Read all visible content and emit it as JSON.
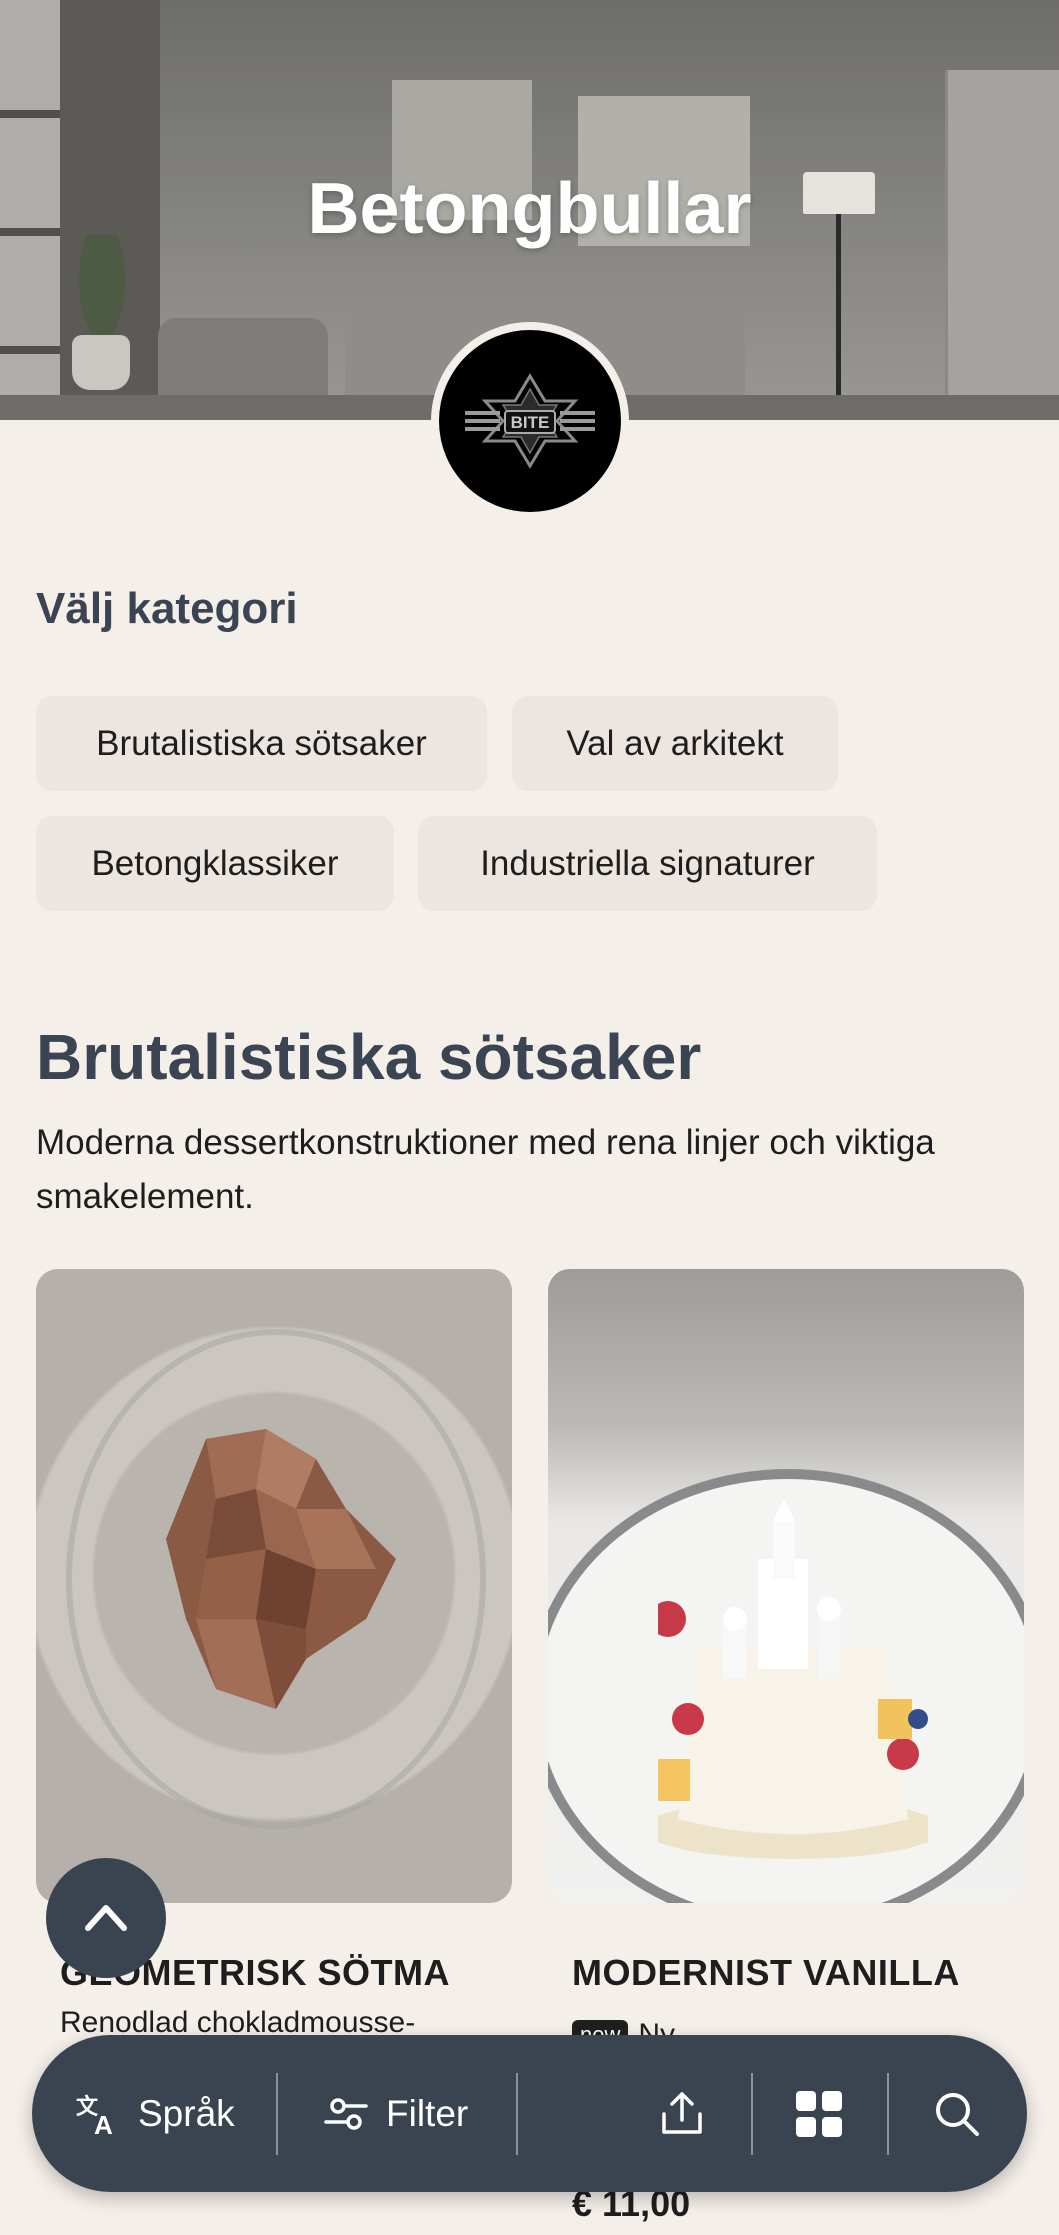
{
  "hero": {
    "title": "Betongbullar",
    "logo_text": "BITE"
  },
  "categories": {
    "heading": "Välj kategori",
    "chips": [
      "Brutalistiska sötsaker",
      "Val av arkitekt",
      "Betongklassiker",
      "Industriella signaturer"
    ]
  },
  "section": {
    "title": "Brutalistiska sötsaker",
    "description": "Moderna dessertkonstruktioner med rena linjer och viktiga smakelement."
  },
  "products": [
    {
      "name": "GEOMETRISK SÖTMA",
      "description": "Renodlad chokladmousse-"
    },
    {
      "name": "MODERNIST VANILLA",
      "badge": "new",
      "badge_label": "Ny",
      "price": "€ 11,00"
    }
  ],
  "bottom_bar": {
    "language_label": "Språk",
    "filter_label": "Filter"
  },
  "colors": {
    "background": "#f5efea",
    "accent_dark": "#3a4450",
    "heading": "#3b4452",
    "chip_bg": "#ece5e0"
  },
  "icons": [
    "translate-icon",
    "filter-icon",
    "share-icon",
    "grid-icon",
    "search-icon",
    "chevron-up-icon"
  ]
}
